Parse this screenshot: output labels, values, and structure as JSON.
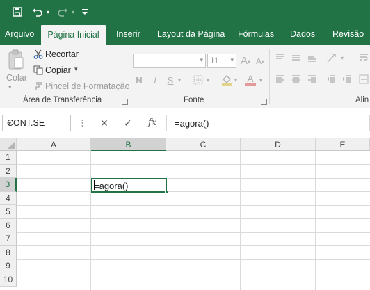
{
  "quick_access": {
    "save_icon": "save-icon",
    "undo_icon": "undo-icon",
    "redo_icon": "redo-icon",
    "customize_icon": "customize-qat-icon"
  },
  "tabs": [
    {
      "label": "Arquivo",
      "active": false
    },
    {
      "label": "Página Inicial",
      "active": true
    },
    {
      "label": "Inserir",
      "active": false
    },
    {
      "label": "Layout da Página",
      "active": false
    },
    {
      "label": "Fórmulas",
      "active": false
    },
    {
      "label": "Dados",
      "active": false
    },
    {
      "label": "Revisão",
      "active": false
    }
  ],
  "clipboard": {
    "paste_label": "Colar",
    "cut_label": "Recortar",
    "copy_label": "Copiar",
    "format_painter_label": "Pincel de Formatação",
    "group_label": "Área de Transferência"
  },
  "font_group": {
    "font_name": "",
    "font_size": "11",
    "bold": "N",
    "italic": "I",
    "underline": "S",
    "grow": "A",
    "shrink": "A",
    "font_color": "A",
    "group_label": "Fonte"
  },
  "alignment_group": {
    "group_label": "Alin"
  },
  "formula_bar": {
    "name_box": "CONT.SE",
    "cancel": "✕",
    "enter": "✓",
    "fx": "fx",
    "content": "=agora()"
  },
  "sheet": {
    "columns": [
      "A",
      "B",
      "C",
      "D",
      "E"
    ],
    "rows": [
      "1",
      "2",
      "3",
      "4",
      "5",
      "6",
      "7",
      "8",
      "9",
      "10"
    ],
    "active_column": "B",
    "active_row": "3",
    "active_cell_text": "=agora()"
  },
  "colors": {
    "brand": "#217346",
    "ribbon_bg": "#f3f3f3"
  }
}
